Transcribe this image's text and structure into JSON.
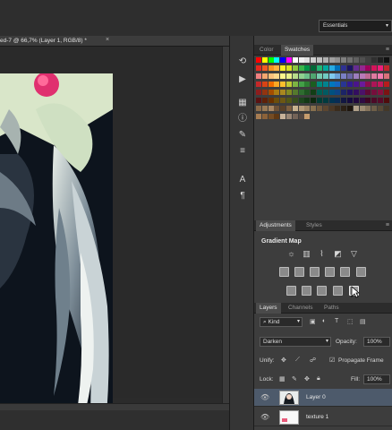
{
  "workspace": {
    "label": "Essentials",
    "arrow": "▾"
  },
  "document_tab": {
    "title": "ed-7 @ 66,7% (Layer 1, RGB/8) *",
    "close": "×"
  },
  "swatches_panel": {
    "tabs": [
      "Color",
      "Swatches"
    ],
    "active_tab": "Swatches",
    "rows": [
      [
        "#ff0000",
        "#ffff00",
        "#00ff00",
        "#00ffff",
        "#0000ff",
        "#ff00ff",
        "#ffffff",
        "#f0f0f0",
        "#e0e0e0",
        "#d0d0d0",
        "#c0c0c0",
        "#b0b0b0",
        "#a0a0a0",
        "#909090",
        "#808080",
        "#707070",
        "#606060",
        "#505050",
        "#404040",
        "#303030",
        "#202020",
        "#101010"
      ],
      [
        "#e6281e",
        "#f15a24",
        "#f7931e",
        "#fbb03b",
        "#fcee21",
        "#d9e021",
        "#8cc63f",
        "#39b54a",
        "#009245",
        "#006837",
        "#22b573",
        "#00a99d",
        "#29abe2",
        "#0071bc",
        "#2e3192",
        "#1b1464",
        "#662d91",
        "#93278f",
        "#9e005d",
        "#d4145a",
        "#ed1e79",
        "#c1272d"
      ],
      [
        "#f08080",
        "#f5a66e",
        "#f9c07b",
        "#fdd78b",
        "#fdf58b",
        "#e8f08a",
        "#b8dc8a",
        "#8fd18f",
        "#6cc08a",
        "#4fa56f",
        "#76ccb0",
        "#6fcbc2",
        "#7fcbee",
        "#6ba3d9",
        "#7a7fc4",
        "#6a66a6",
        "#9c7dbd",
        "#b87ab8",
        "#bf6a93",
        "#e07aa0",
        "#f27aaf",
        "#d87079"
      ],
      [
        "#c62828",
        "#d84315",
        "#ef6c00",
        "#f9a825",
        "#fbc02d",
        "#c0ca33",
        "#7cb342",
        "#43a047",
        "#2e7d32",
        "#1b5e20",
        "#00897b",
        "#00838f",
        "#0277bd",
        "#1565c0",
        "#283593",
        "#311b92",
        "#4a148c",
        "#6a1b9a",
        "#880e4f",
        "#ad1457",
        "#c2185b",
        "#b71c1c"
      ],
      [
        "#8d1d1d",
        "#93340f",
        "#a44d00",
        "#a87b14",
        "#a9881f",
        "#818a22",
        "#55792d",
        "#2e6c2f",
        "#1f5522",
        "#123e16",
        "#005e53",
        "#005a62",
        "#00517f",
        "#0d4484",
        "#1b2466",
        "#221263",
        "#330d60",
        "#4a1269",
        "#5d0a36",
        "#760e3c",
        "#86103f",
        "#7c1313"
      ],
      [
        "#5a1212",
        "#5e2109",
        "#693100",
        "#6b4e0c",
        "#6c5713",
        "#525815",
        "#374d1d",
        "#1e451e",
        "#143816",
        "#0c280e",
        "#003c35",
        "#003a3f",
        "#003452",
        "#082c55",
        "#121742",
        "#150b40",
        "#21083e",
        "#2f0b43",
        "#3c0623",
        "#4c0927",
        "#570a29",
        "#500c0c"
      ],
      [
        "#8b6b4a",
        "#9a7a56",
        "#a88763",
        "#6e5236",
        "#5a4128",
        "#7d5f3f",
        "#c8b28f",
        "#b39a77",
        "#9d8463",
        "#87704f",
        "#70593d",
        "#5c4630",
        "#4a3826",
        "#3a2c1d",
        "#2c2116",
        "#1e160e",
        "#b0a08a",
        "#9c8a72",
        "#85735c",
        "#6e5e48",
        "#584a37",
        "#443828"
      ],
      [
        "#a67c52",
        "#8c6239",
        "#754c24",
        "#603813",
        "#c7b299",
        "#998675",
        "#736357",
        "#534741",
        "#c69c6d",
        "",
        "",
        "",
        "",
        "",
        "",
        "",
        "",
        "",
        "",
        "",
        "",
        ""
      ]
    ]
  },
  "adjustments_panel": {
    "tabs": [
      "Adjustments",
      "Styles"
    ],
    "active_tab": "Adjustments",
    "title": "Gradient Map"
  },
  "layers_panel": {
    "tabs": [
      "Layers",
      "Channels",
      "Paths"
    ],
    "active_tab": "Layers",
    "filter_kind": "Kind",
    "blend_mode": "Darken",
    "opacity_label": "Opacity:",
    "opacity_value": "100%",
    "unify_label": "Unify:",
    "propagate_label": "Propagate Frame",
    "lock_label": "Lock:",
    "fill_label": "Fill:",
    "fill_value": "100%",
    "layers": [
      {
        "name": "Layer 0",
        "selected": true
      },
      {
        "name": "texture 1",
        "selected": false
      }
    ]
  }
}
